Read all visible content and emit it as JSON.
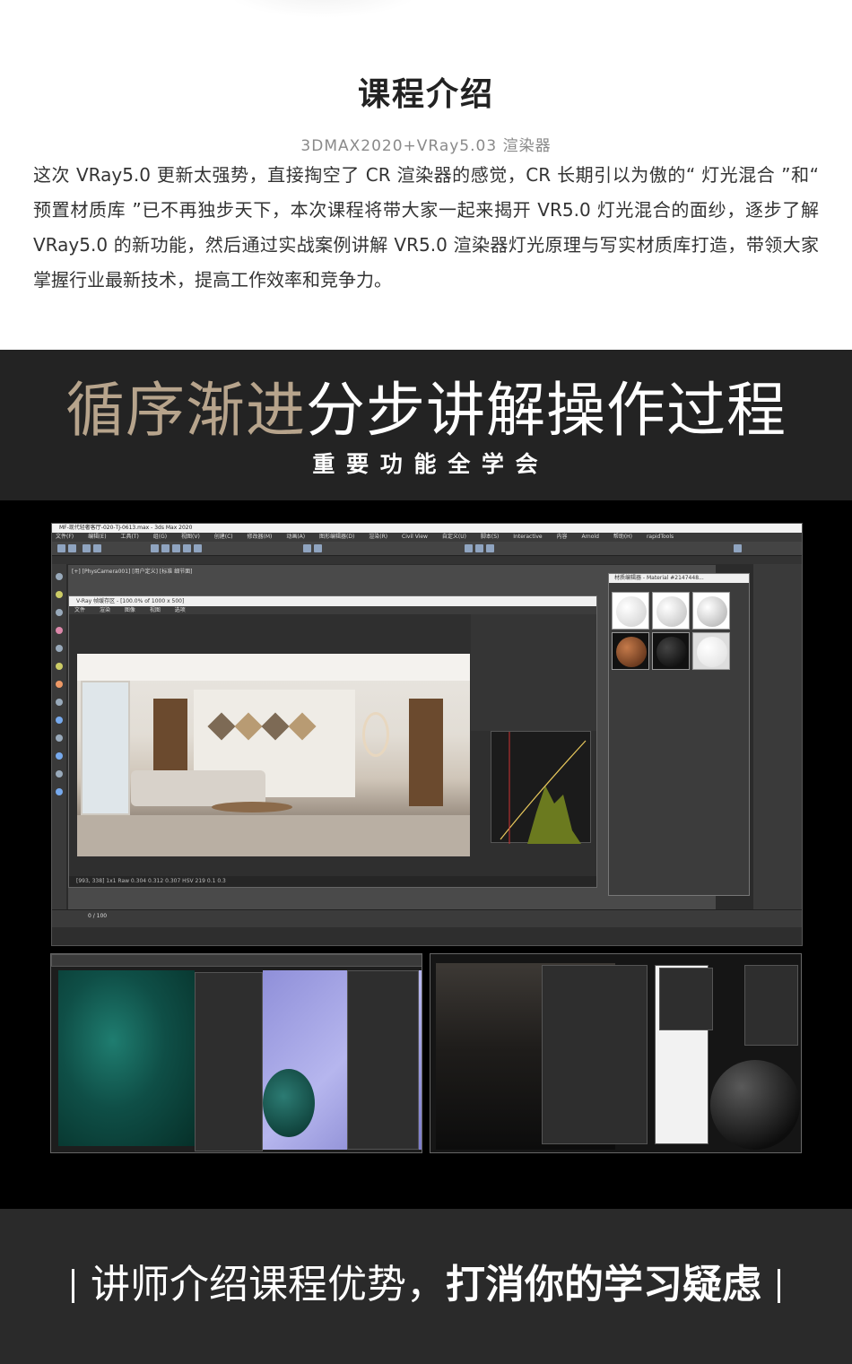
{
  "intro": {
    "title": "课程介绍",
    "subtitle": "3DMAX2020+VRay5.03 渲染器",
    "body": "这次 VRay5.0 更新太强势，直接掏空了 CR 渲染器的感觉，CR 长期引以为傲的“ 灯光混合 ”和“ 预置材质库 ”已不再独步天下，本次课程将带大家一起来揭开 VR5.0 灯光混合的面纱，逐步了解 VRay5.0 的新功能，然后通过实战案例讲解 VR5.0 渲染器灯光原理与写实材质库打造，带领大家掌握行业最新技术，提高工作效率和竞争力。"
  },
  "banner": {
    "headline_gold": "循序渐进",
    "headline_white": "分步讲解操作过程",
    "subline": "重 要 功 能 全 学 会"
  },
  "main_screenshot": {
    "window_title": "MF-现代轻奢客厅-020-TJ-0613.max - 3ds Max 2020",
    "menu": [
      "文件(F)",
      "编辑(E)",
      "工具(T)",
      "组(G)",
      "视图(V)",
      "创建(C)",
      "修改器(M)",
      "动画(A)",
      "图形编辑器(D)",
      "渲染(R)",
      "Civil View",
      "自定义(U)",
      "脚本(S)",
      "Interactive",
      "内容",
      "Arnold",
      "帮助(H)",
      "rapidTools"
    ],
    "viewport_label": "[+] [PhysCamera001] [用户定义] [标准 细节面]",
    "vfb_title": "V-Ray 帧缓存区 - [100.0% of 1000 x 500]",
    "vfb_menu": [
      "文件",
      "渲染",
      "图像",
      "视图",
      "选项"
    ],
    "vfb_status": "[993, 338]   1x1  Raw  0.304  0.312  0.307  HSV  219  0.1  0.3",
    "material_editor_title": "材质编辑器 - Material #2147448...",
    "frame_counter": "0 / 100"
  },
  "footer": {
    "text_light": "讲师介绍课程优势，",
    "text_bold": "打消你的学习疑虑"
  }
}
